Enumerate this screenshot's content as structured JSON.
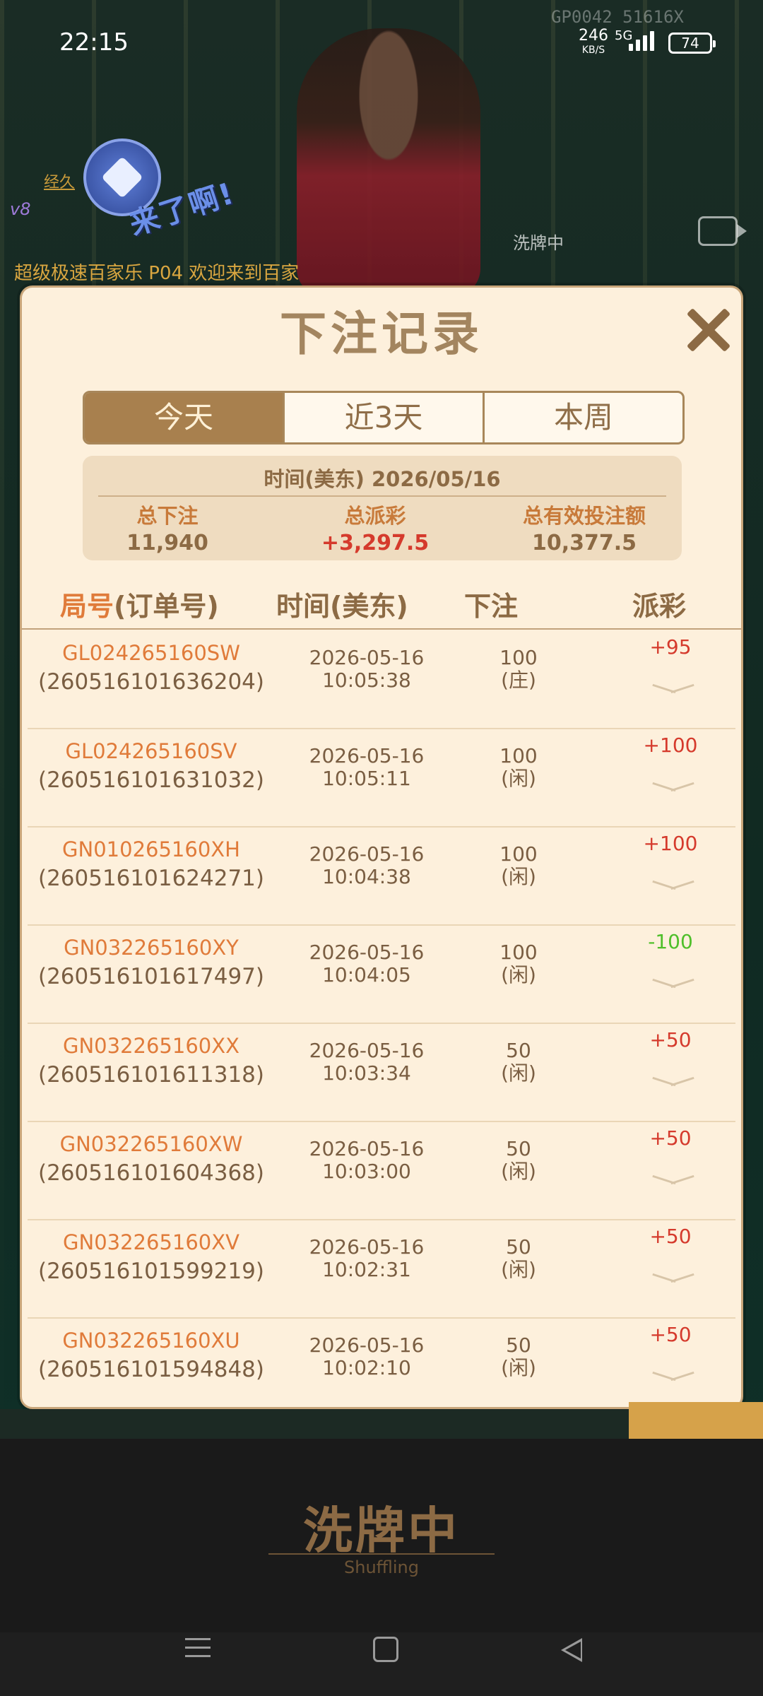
{
  "status_bar": {
    "time": "22:15",
    "net_speed": "246",
    "net_unit": "KB/S",
    "net_type": "5G",
    "battery": "74"
  },
  "background": {
    "top_code": "GP0042 51616X",
    "promo_text": "来了啊!",
    "link_text": "经久",
    "badge": "v8",
    "shuffling_label": "洗牌中",
    "marquee": "超级极速百家乐 P04 欢迎来到百家"
  },
  "modal": {
    "title": "下注记录",
    "tabs": [
      {
        "label": "今天",
        "active": true
      },
      {
        "label": "近3天",
        "active": false
      },
      {
        "label": "本周",
        "active": false
      }
    ],
    "summary": {
      "time": "时间(美东) 2026/05/16",
      "total_bet_label": "总下注",
      "total_bet_value": "11,940",
      "total_payout_label": "总派彩",
      "total_payout_value": "+3,297.5",
      "total_valid_label": "总有效投注额",
      "total_valid_value": "10,377.5"
    },
    "columns": {
      "id_highlight": "局号",
      "id_rest": "(订单号)",
      "time": "时间(美东)",
      "bet": "下注",
      "payout": "派彩"
    },
    "rows": [
      {
        "game_id": "GL024265160SW",
        "order_id": "(260516101636204)",
        "date": "2026-05-16",
        "time": "10:05:38",
        "bet": "100",
        "side": "(庄)",
        "payout": "+95",
        "result": "win"
      },
      {
        "game_id": "GL024265160SV",
        "order_id": "(260516101631032)",
        "date": "2026-05-16",
        "time": "10:05:11",
        "bet": "100",
        "side": "(闲)",
        "payout": "+100",
        "result": "win"
      },
      {
        "game_id": "GN010265160XH",
        "order_id": "(260516101624271)",
        "date": "2026-05-16",
        "time": "10:04:38",
        "bet": "100",
        "side": "(闲)",
        "payout": "+100",
        "result": "win"
      },
      {
        "game_id": "GN032265160XY",
        "order_id": "(260516101617497)",
        "date": "2026-05-16",
        "time": "10:04:05",
        "bet": "100",
        "side": "(闲)",
        "payout": "-100",
        "result": "loss"
      },
      {
        "game_id": "GN032265160XX",
        "order_id": "(260516101611318)",
        "date": "2026-05-16",
        "time": "10:03:34",
        "bet": "50",
        "side": "(闲)",
        "payout": "+50",
        "result": "win"
      },
      {
        "game_id": "GN032265160XW",
        "order_id": "(260516101604368)",
        "date": "2026-05-16",
        "time": "10:03:00",
        "bet": "50",
        "side": "(闲)",
        "payout": "+50",
        "result": "win"
      },
      {
        "game_id": "GN032265160XV",
        "order_id": "(260516101599219)",
        "date": "2026-05-16",
        "time": "10:02:31",
        "bet": "50",
        "side": "(闲)",
        "payout": "+50",
        "result": "win"
      },
      {
        "game_id": "GN032265160XU",
        "order_id": "(260516101594848)",
        "date": "2026-05-16",
        "time": "10:02:10",
        "bet": "50",
        "side": "(闲)",
        "payout": "+50",
        "result": "win"
      }
    ]
  },
  "shuffle_banner": {
    "title": "洗牌中",
    "subtitle": "Shuffling"
  },
  "colors": {
    "modal_bg": "#fdf0dc",
    "accent_gold": "#a8804e",
    "win_red": "#d53a2c",
    "loss_green": "#4fbf2a",
    "id_orange": "#e07b3a"
  }
}
